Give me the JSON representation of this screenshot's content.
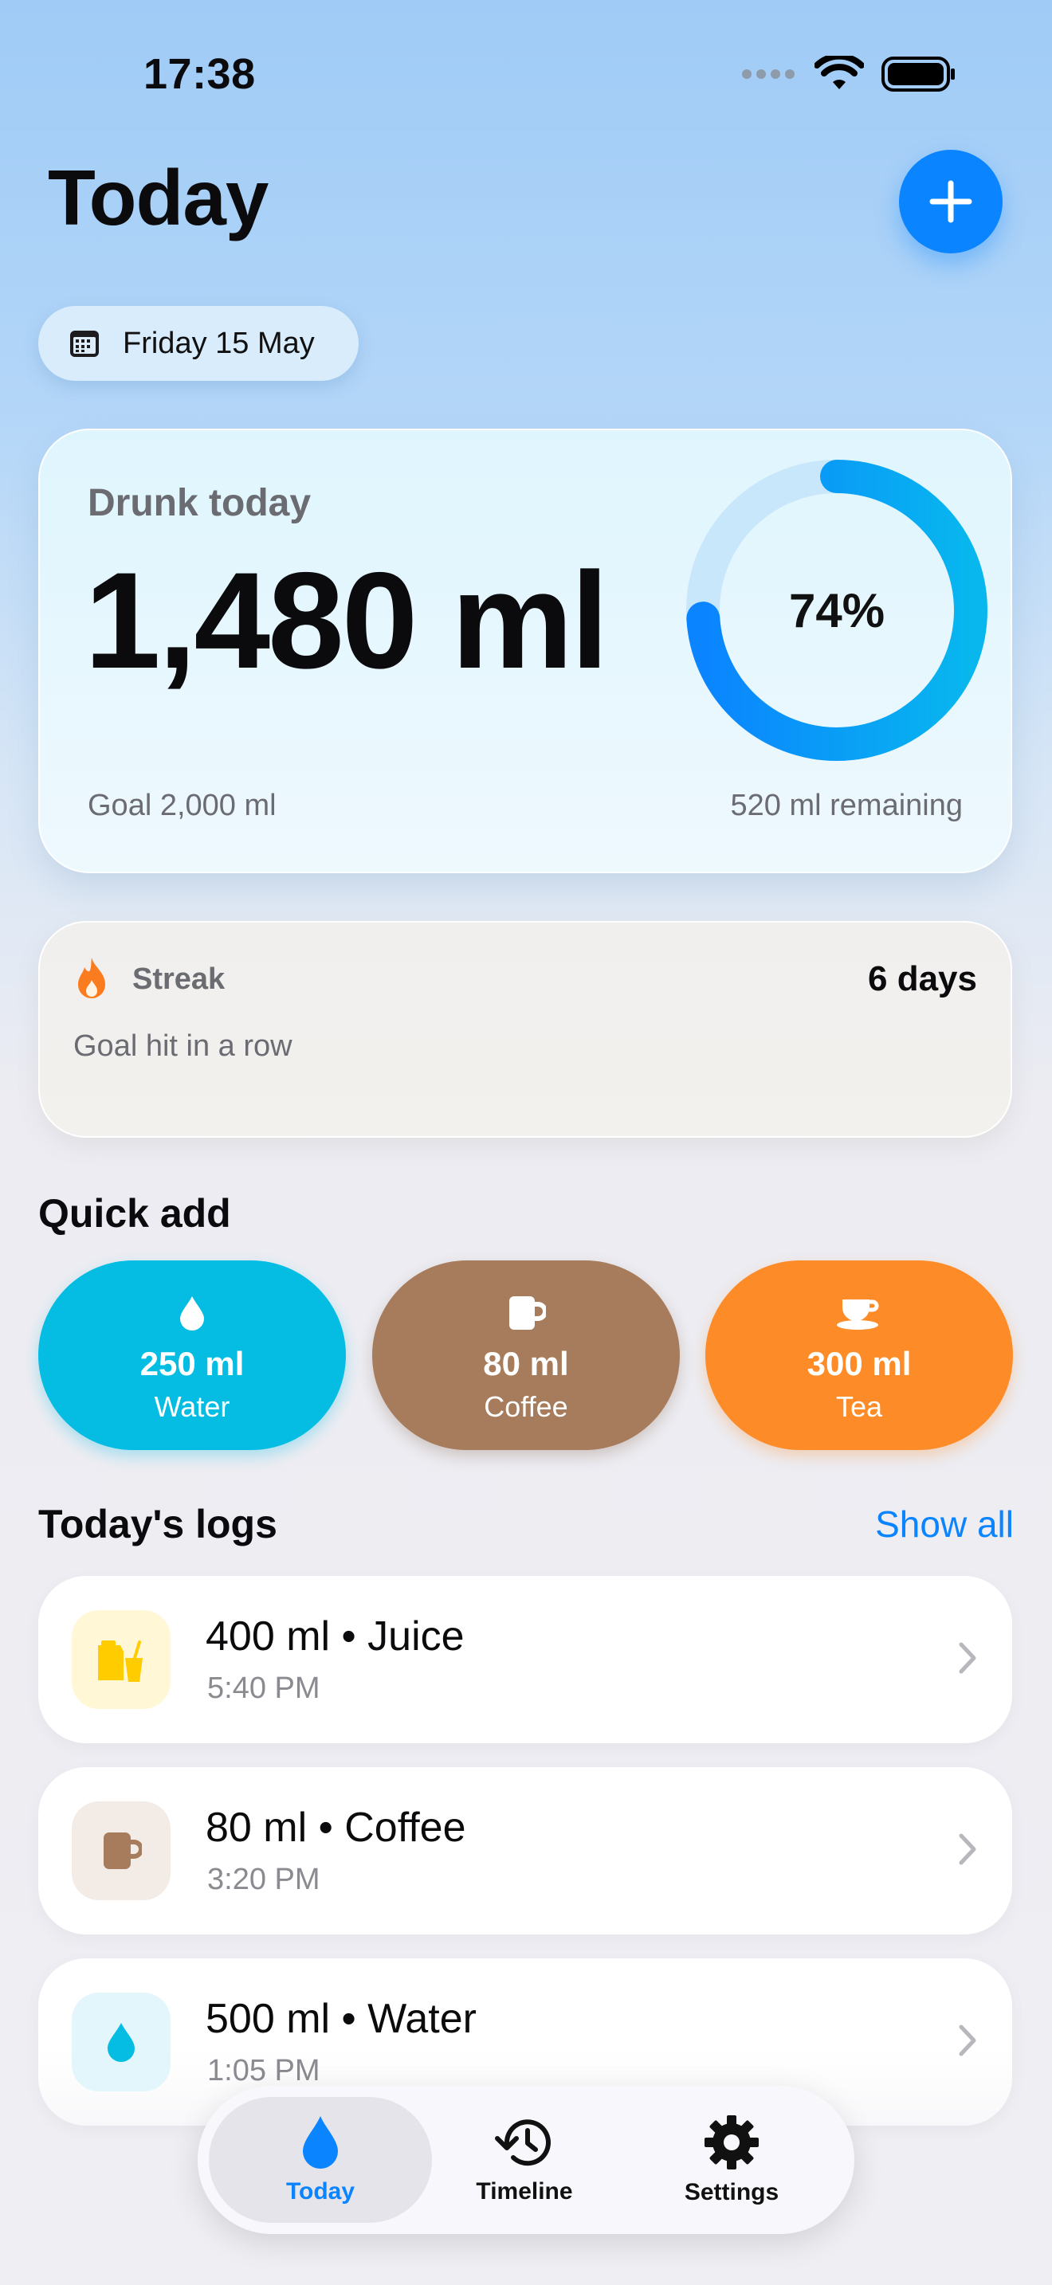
{
  "status": {
    "time": "17:38"
  },
  "header": {
    "title": "Today",
    "add_icon": "plus-icon"
  },
  "date_chip": {
    "label": "Friday 15 May",
    "icon": "calendar-icon"
  },
  "summary": {
    "label": "Drunk today",
    "value": "1,480 ml",
    "percent_label": "74%",
    "progress": 0.74,
    "goal": "Goal 2,000 ml",
    "remaining": "520 ml remaining",
    "colors": {
      "ring_fill": "#0a9cf5",
      "ring_track": "#c8e7fb"
    }
  },
  "streak": {
    "label": "Streak",
    "days": "6 days",
    "subtitle": "Goal hit in a row",
    "icon": "flame-icon"
  },
  "quick_add": {
    "title": "Quick add",
    "items": [
      {
        "amount": "250 ml",
        "name": "Water",
        "icon": "drop-icon",
        "color": "#05bde3"
      },
      {
        "amount": "80 ml",
        "name": "Coffee",
        "icon": "mug-icon",
        "color": "#a67c5c"
      },
      {
        "amount": "300 ml",
        "name": "Tea",
        "icon": "teacup-icon",
        "color": "#fd8c28"
      }
    ]
  },
  "logs": {
    "title": "Today's logs",
    "show_all": "Show all",
    "items": [
      {
        "main": "400 ml • Juice",
        "time": "5:40 PM",
        "icon": "juice-icon",
        "bg": "#fff7d6"
      },
      {
        "main": "80 ml • Coffee",
        "time": "3:20 PM",
        "icon": "mug-icon",
        "bg": "#f3ece6"
      },
      {
        "main": "500 ml • Water",
        "time": "1:05 PM",
        "icon": "drop-icon",
        "bg": "#e2f6fb"
      }
    ]
  },
  "tabbar": {
    "tabs": [
      {
        "label": "Today",
        "icon": "drop-icon",
        "active": true
      },
      {
        "label": "Timeline",
        "icon": "history-icon",
        "active": false
      },
      {
        "label": "Settings",
        "icon": "gear-icon",
        "active": false
      }
    ]
  }
}
